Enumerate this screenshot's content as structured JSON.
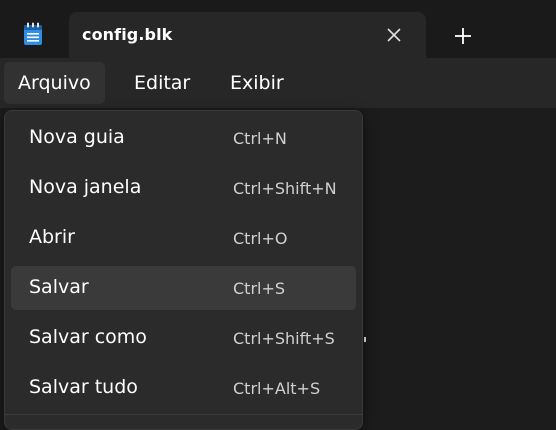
{
  "window": {
    "tab_title": "config.blk",
    "close_tab_glyph": "close-icon",
    "new_tab_glyph": "plus-icon",
    "app_icon": "notepad-icon"
  },
  "menubar": {
    "items": [
      {
        "label": "Arquivo"
      },
      {
        "label": "Editar"
      },
      {
        "label": "Exibir"
      }
    ],
    "active_index": 0
  },
  "file_menu": {
    "items": [
      {
        "label": "Nova guia",
        "shortcut": "Ctrl+N"
      },
      {
        "label": "Nova janela",
        "shortcut": "Ctrl+Shift+N"
      },
      {
        "label": "Abrir",
        "shortcut": "Ctrl+O"
      },
      {
        "label": "Salvar",
        "shortcut": "Ctrl+S"
      },
      {
        "label": "Salvar como",
        "shortcut": "Ctrl+Shift+S"
      },
      {
        "label": "Salvar tudo",
        "shortcut": "Ctrl+Alt+S"
      }
    ],
    "hovered_index": 3
  },
  "colors": {
    "background": "#1c1c1c",
    "menu_bg": "#2b2b2b",
    "hover_bg": "#3a3a3a",
    "icon_accent": "#2f8de4"
  }
}
